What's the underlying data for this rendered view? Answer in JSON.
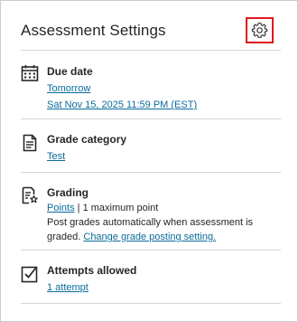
{
  "panel": {
    "title": "Assessment Settings",
    "settings_icon": "gear-icon"
  },
  "due_date": {
    "icon": "calendar-icon",
    "label": "Due date",
    "relative": "Tomorrow",
    "datetime": "Sat Nov 15, 2025 11:59 PM (EST)"
  },
  "grade_category": {
    "icon": "document-icon",
    "label": "Grade category",
    "value": "Test"
  },
  "grading": {
    "icon": "grading-star-icon",
    "label": "Grading",
    "schema": "Points",
    "separator": "|",
    "max_points": "1 maximum point",
    "posting_text": "Post grades automatically when assessment is graded.",
    "posting_link": "Change grade posting setting."
  },
  "attempts": {
    "icon": "checkbox-icon",
    "label": "Attempts allowed",
    "value": "1 attempt"
  },
  "colors": {
    "link": "#0a6b9c",
    "highlight_border": "#e1171e",
    "divider": "#d6d6d6"
  }
}
